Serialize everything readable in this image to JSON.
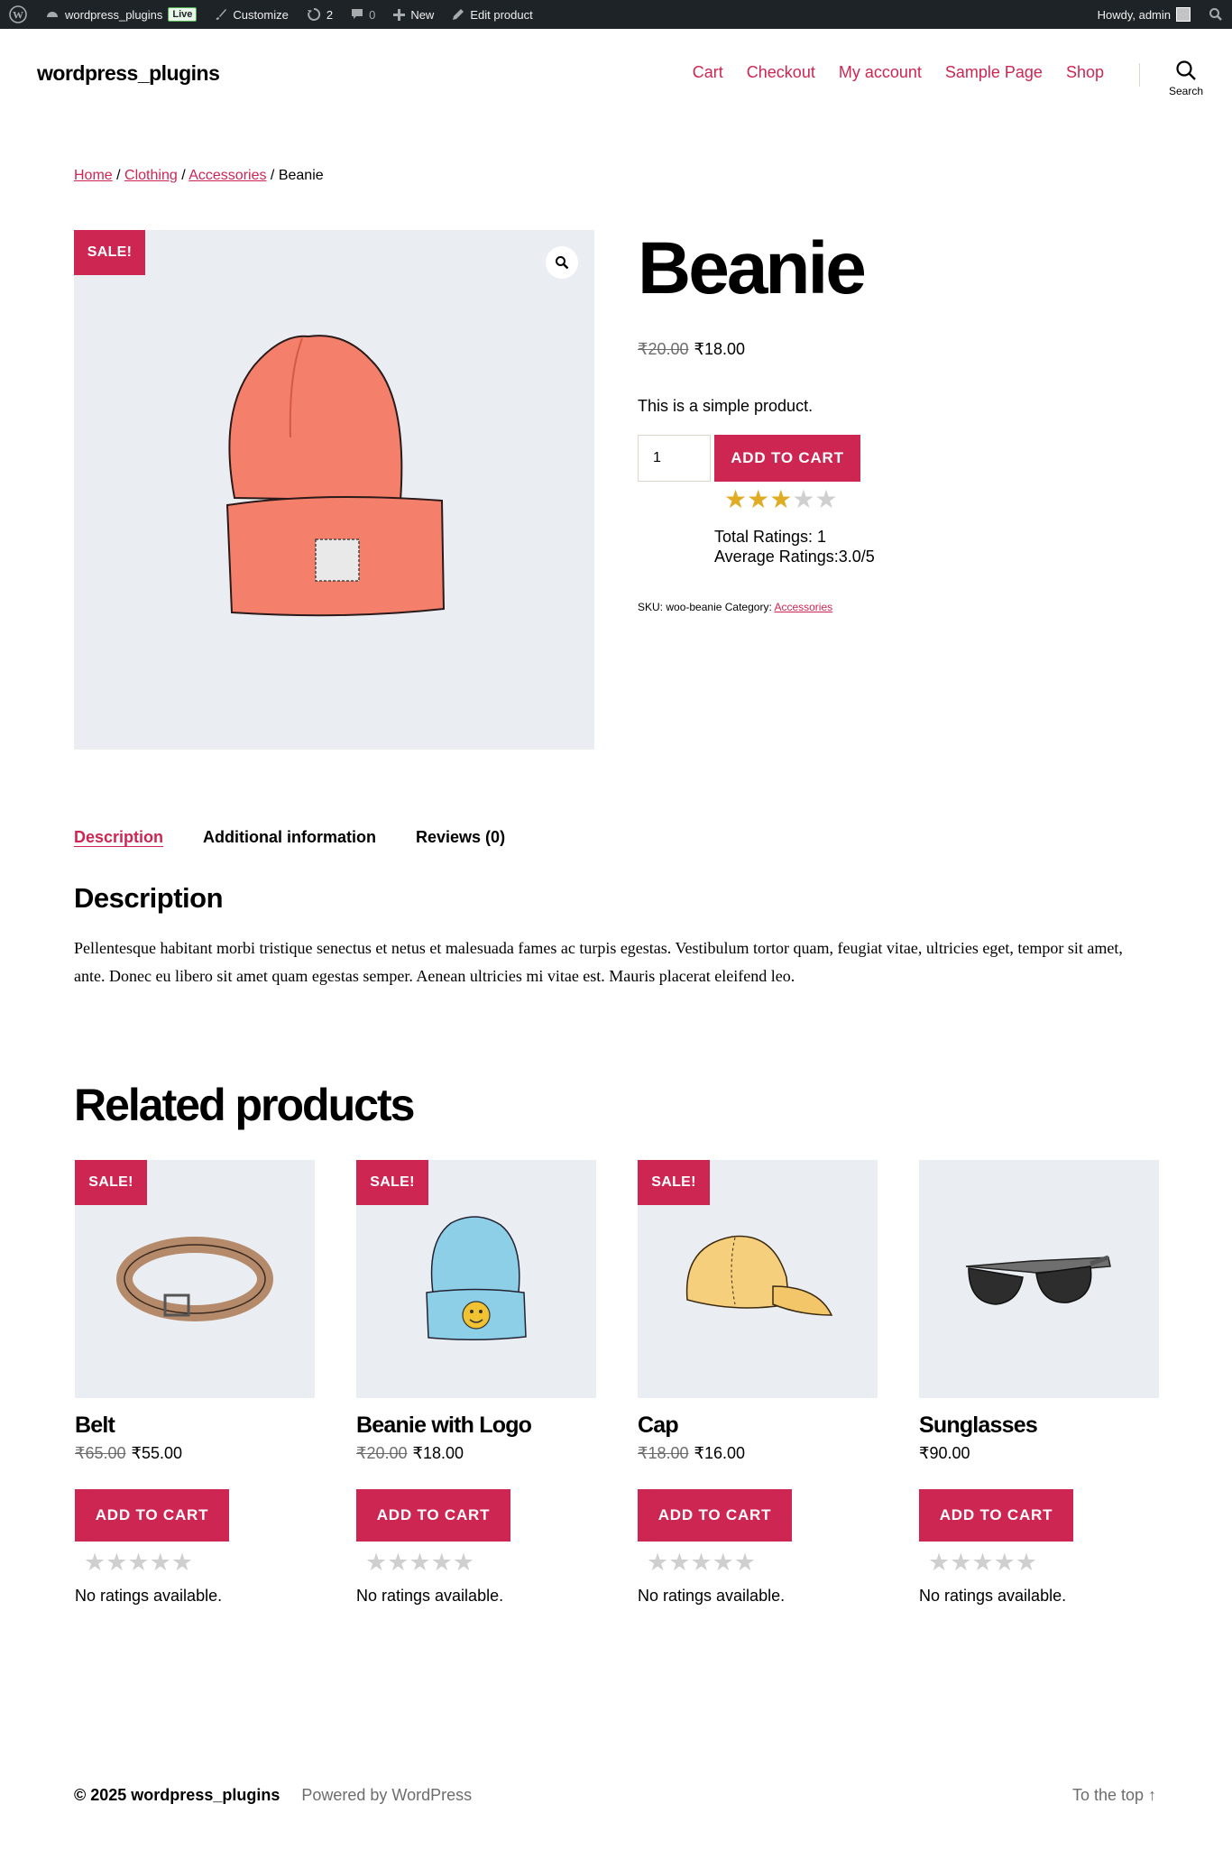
{
  "admin_bar": {
    "site_name": "wordpress_plugins",
    "live_badge": "Live",
    "customize": "Customize",
    "updates_count": "2",
    "comments_count": "0",
    "new": "New",
    "edit_product": "Edit product",
    "howdy": "Howdy, admin"
  },
  "header": {
    "site_title": "wordpress_plugins",
    "nav": [
      "Cart",
      "Checkout",
      "My account",
      "Sample Page",
      "Shop"
    ],
    "search_label": "Search"
  },
  "breadcrumb": {
    "home": "Home",
    "clothing": "Clothing",
    "accessories": "Accessories",
    "current": "Beanie",
    "sep": "/"
  },
  "product": {
    "sale_badge": "SALE!",
    "title": "Beanie",
    "price_old": "₹20.00",
    "price_new": "₹18.00",
    "short_description": "This is a simple product.",
    "quantity": "1",
    "add_to_cart": "ADD TO CART",
    "rating": 3,
    "rating_max": 5,
    "total_ratings": "Total Ratings: 1",
    "average_ratings": "Average Ratings:3.0/5",
    "sku_label": "SKU:",
    "sku": "woo-beanie",
    "category_label": "Category:",
    "category": "Accessories"
  },
  "tabs": {
    "description": "Description",
    "additional": "Additional information",
    "reviews": "Reviews (0)"
  },
  "description": {
    "heading": "Description",
    "text": "Pellentesque habitant morbi tristique senectus et netus et malesuada fames ac turpis egestas. Vestibulum tortor quam, feugiat vitae, ultricies eget, tempor sit amet, ante. Donec eu libero sit amet quam egestas semper. Aenean ultricies mi vitae est. Mauris placerat eleifend leo."
  },
  "related": {
    "heading": "Related products",
    "items": [
      {
        "title": "Belt",
        "price_old": "₹65.00",
        "price_new": "₹55.00",
        "sale": "SALE!",
        "button": "ADD TO CART",
        "no_ratings": "No ratings available.",
        "icon": "belt-image"
      },
      {
        "title": "Beanie with Logo",
        "price_old": "₹20.00",
        "price_new": "₹18.00",
        "sale": "SALE!",
        "button": "ADD TO CART",
        "no_ratings": "No ratings available.",
        "icon": "beanie-logo-image"
      },
      {
        "title": "Cap",
        "price_old": "₹18.00",
        "price_new": "₹16.00",
        "sale": "SALE!",
        "button": "ADD TO CART",
        "no_ratings": "No ratings available.",
        "icon": "cap-image"
      },
      {
        "title": "Sunglasses",
        "price_old": "",
        "price_new": "₹90.00",
        "sale": "",
        "button": "ADD TO CART",
        "no_ratings": "No ratings available.",
        "icon": "sunglasses-image"
      }
    ]
  },
  "footer": {
    "copyright": "© 2025 wordpress_plugins",
    "powered": "Powered by WordPress",
    "to_top": "To the top ↑"
  },
  "colors": {
    "accent": "#cd2653",
    "admin_bar": "#1d2327",
    "image_bg": "#eaeef2",
    "star": "#e0ac24"
  }
}
